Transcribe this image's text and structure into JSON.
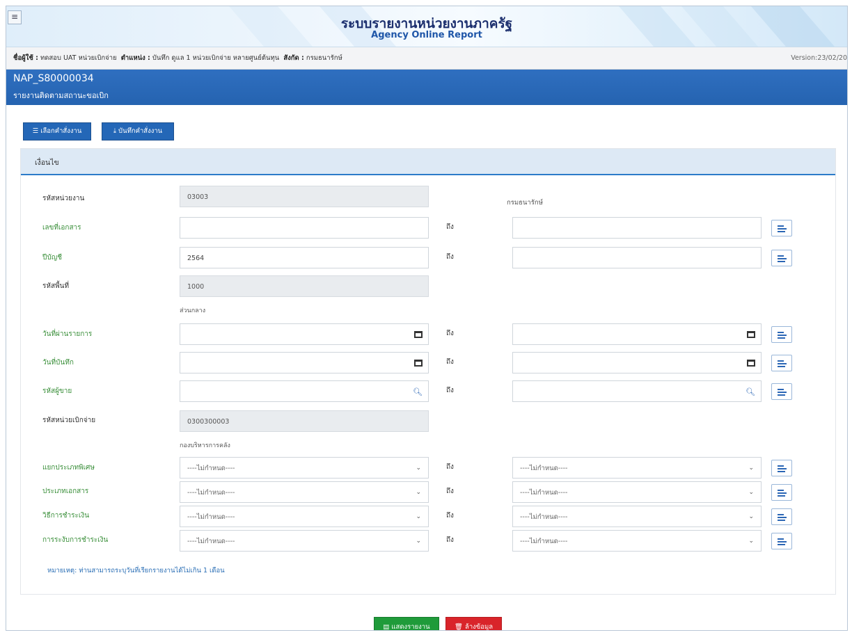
{
  "header": {
    "title_th": "ระบบรายงานหน่วยงานภาครัฐ",
    "title_en": "Agency Online Report",
    "menu_icon": "hamburger-icon"
  },
  "userbar": {
    "user_label": "ชื่อผู้ใช้ :",
    "user_value": "ทดสอบ UAT หน่วยเบิกจ่าย",
    "position_label": "ตำแหน่ง :",
    "position_value": "บันทึก ดูแล 1 หน่วยเบิกจ่าย หลายศูนย์ต้นทุน",
    "affil_label": "สังกัด :",
    "affil_value": "กรมธนารักษ์",
    "version": "Version:23/02/20"
  },
  "page": {
    "code": "NAP_S80000034",
    "name": "รายงานติดตามสถานะขอเบิก"
  },
  "toolbar": {
    "select_label": "เลือกคำสั่งงาน",
    "save_label": "บันทึกคำสั่งงาน"
  },
  "panel": {
    "title": "เงื่อนไข"
  },
  "form": {
    "to_label": "ถึง",
    "agency": {
      "label": "รหัสหน่วยงาน",
      "value": "03003",
      "name": "กรมธนารักษ์"
    },
    "doc_no": {
      "label": "เลขที่เอกสาร",
      "from": "",
      "to": ""
    },
    "fiscal_year": {
      "label": "ปีบัญชี",
      "from": "2564",
      "to": ""
    },
    "area": {
      "label": "รหัสพื้นที่",
      "value": "1000",
      "name": "ส่วนกลาง"
    },
    "post_date": {
      "label": "วันที่ผ่านรายการ",
      "from": "",
      "to": ""
    },
    "entry_date": {
      "label": "วันที่บันทึก",
      "from": "",
      "to": ""
    },
    "vendor": {
      "label": "รหัสผู้ขาย",
      "from": "",
      "to": ""
    },
    "disb_unit": {
      "label": "รหัสหน่วยเบิกจ่าย",
      "value": "0300300003",
      "name": "กองบริหารการคลัง"
    },
    "special_type": {
      "label": "แยกประเภทพิเศษ",
      "from": "----ไม่กำหนด----",
      "to": "----ไม่กำหนด----"
    },
    "doc_type": {
      "label": "ประเภทเอกสาร",
      "from": "----ไม่กำหนด----",
      "to": "----ไม่กำหนด----"
    },
    "pay_method": {
      "label": "วิธีการชำระเงิน",
      "from": "----ไม่กำหนด----",
      "to": "----ไม่กำหนด----"
    },
    "pay_block": {
      "label": "การระงับการชำระเงิน",
      "from": "----ไม่กำหนด----",
      "to": "----ไม่กำหนด----"
    },
    "note": "หมายเหตุ: ท่านสามารถระบุวันที่เรียกรายงานได้ไม่เกิน 1 เดือน"
  },
  "actions": {
    "show_label": "แสดงรายงาน",
    "clear_label": "ล้างข้อมูล"
  },
  "colors": {
    "primary": "#2467b7",
    "green": "#1f9b3a",
    "red": "#d9242a",
    "label_green": "#3a8f3a"
  }
}
